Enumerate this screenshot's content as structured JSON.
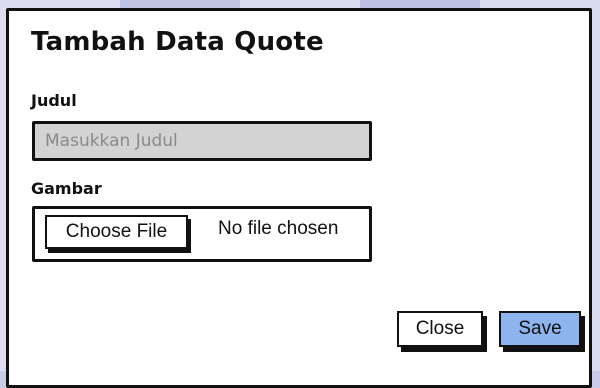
{
  "dialog": {
    "title": "Tambah Data Quote"
  },
  "form": {
    "judul": {
      "label": "Judul",
      "placeholder": "Masukkan Judul",
      "value": ""
    },
    "gambar": {
      "label": "Gambar",
      "choose_label": "Choose File",
      "status": "No file chosen"
    }
  },
  "actions": {
    "close_label": "Close",
    "save_label": "Save",
    "save_color": "#8db4ec"
  }
}
